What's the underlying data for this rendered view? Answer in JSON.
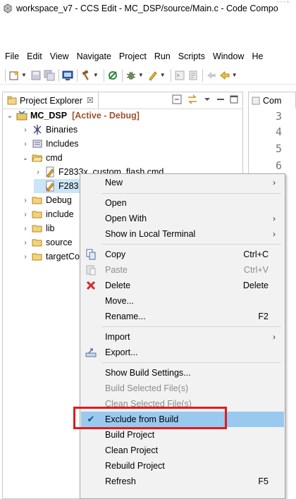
{
  "window": {
    "title": "workspace_v7 - CCS Edit - MC_DSP/source/Main.c - Code Compo",
    "corner_glyph": "' ' ' ''"
  },
  "menubar": [
    "File",
    "Edit",
    "View",
    "Navigate",
    "Project",
    "Run",
    "Scripts",
    "Window",
    "He"
  ],
  "toolbar_icons": [
    "new-wizard-icon",
    "save-icon",
    "save-all-icon",
    "terminal-icon",
    "build-hammer-icon",
    "debug-icon",
    "bug-icon",
    "flash-icon",
    "console-icon",
    "editor-icon",
    "back-icon"
  ],
  "explorer": {
    "tab_label": "Project Explorer",
    "close_glyph": "☒",
    "project": {
      "name": "MC_DSP",
      "status": "[Active - Debug]"
    },
    "items": [
      {
        "label": "Binaries"
      },
      {
        "label": "Includes"
      },
      {
        "label": "cmd"
      },
      {
        "label": "F2833x_custom_flash.cmd"
      },
      {
        "label": "F283"
      },
      {
        "label": "Debug"
      },
      {
        "label": "include"
      },
      {
        "label": "lib"
      },
      {
        "label": "source"
      },
      {
        "label": "targetCo"
      }
    ]
  },
  "editor": {
    "tab_label": "Com",
    "line_numbers": [
      "3",
      "4",
      "5",
      "6"
    ]
  },
  "context_menu": {
    "items": [
      {
        "label": "New",
        "submenu": "›"
      },
      {
        "label": "Open"
      },
      {
        "label": "Open With",
        "submenu": "›"
      },
      {
        "label": "Show in Local Terminal",
        "submenu": "›"
      },
      {
        "label": "Copy",
        "shortcut": "Ctrl+C"
      },
      {
        "label": "Paste",
        "shortcut": "Ctrl+V"
      },
      {
        "label": "Delete",
        "shortcut": "Delete"
      },
      {
        "label": "Move..."
      },
      {
        "label": "Rename...",
        "shortcut": "F2"
      },
      {
        "label": "Import",
        "submenu": "›"
      },
      {
        "label": "Export..."
      },
      {
        "label": "Show Build Settings..."
      },
      {
        "label": "Build Selected File(s)"
      },
      {
        "label": "Clean Selected File(s)"
      },
      {
        "label": "Exclude from Build",
        "check": "✔"
      },
      {
        "label": "Build Project"
      },
      {
        "label": "Clean Project"
      },
      {
        "label": "Rebuild Project"
      },
      {
        "label": "Refresh",
        "shortcut": "F5"
      }
    ]
  },
  "colors": {
    "highlight": "#99c9ef",
    "annotation_box": "#e11b1b",
    "delete_icon": "#d8282a",
    "status": "#a0522d"
  }
}
